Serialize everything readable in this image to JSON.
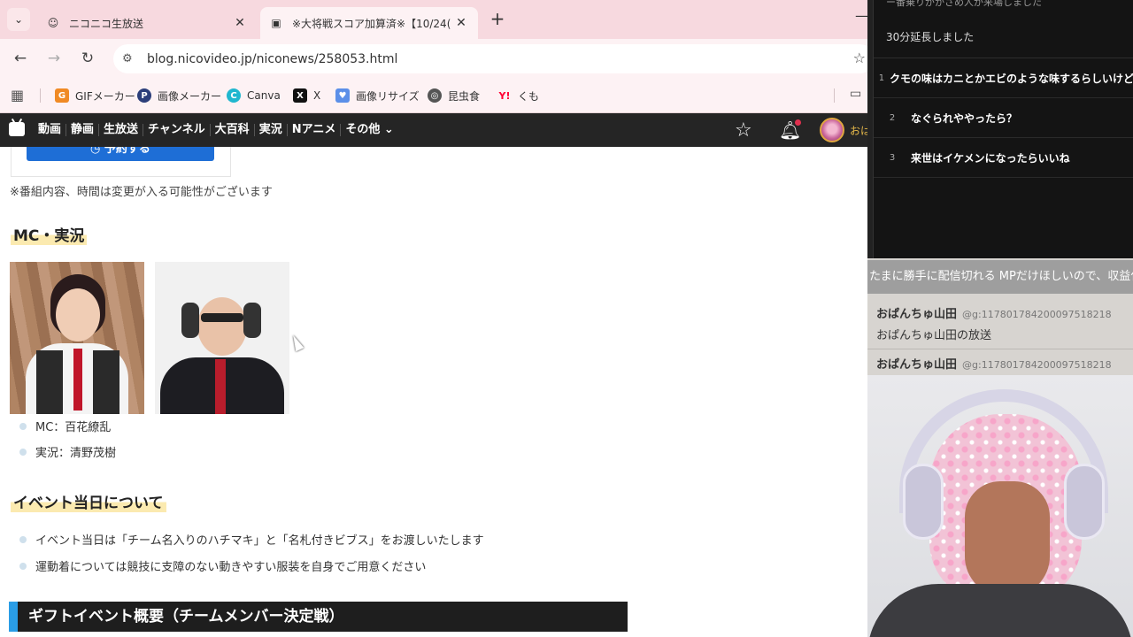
{
  "browser": {
    "tabs": [
      {
        "title": "ニコニコ生放送",
        "active": false
      },
      {
        "title": "※大将戦スコア加算済※【10/24(",
        "active": true
      }
    ],
    "url": "blog.nicovideo.jp/niconews/258053.html",
    "bookmarks": [
      {
        "label": "GIFメーカー",
        "icon": "gif-maker-icon",
        "color": "#f08a24"
      },
      {
        "label": "画像メーカー",
        "icon": "image-maker-icon",
        "color": "#2c3e7a"
      },
      {
        "label": "Canva",
        "icon": "canva-icon",
        "color": "#20b7cf"
      },
      {
        "label": "X",
        "icon": "x-icon",
        "color": "#111111"
      },
      {
        "label": "画像リサイズ",
        "icon": "resize-icon",
        "color": "#5b8fe8"
      },
      {
        "label": "昆虫食",
        "icon": "insect-food-icon",
        "color": "#555555"
      },
      {
        "label": "くも",
        "icon": "yahoo-icon",
        "color": "#ff0033"
      }
    ]
  },
  "sitenav": {
    "items": [
      "動画",
      "静画",
      "生放送",
      "チャンネル",
      "大百科",
      "実況",
      "Nアニメ",
      "その他"
    ],
    "more_suffix": "⌄",
    "user_label": "おは"
  },
  "article": {
    "reserve_label": "予約する",
    "note": "※番組内容、時間は変更が入る可能性がございます",
    "mc_heading": "MC・実況",
    "mc_items": [
      "MC：百花繚乱",
      "実況：清野茂樹"
    ],
    "event_heading": "イベント当日について",
    "event_items": [
      "イベント当日は「チーム名入りのハチマキ」と「名札付きビブス」をお渡しいたします",
      "運動着については競技に支障のない動きやすい服装を自身でご用意ください"
    ],
    "gift_heading": "ギフトイベント概要（チームメンバー決定戦）"
  },
  "stream": {
    "top_text": "ー番乗りがかさめ人が来場しました",
    "extend_text": "30分延長しました",
    "ranking": [
      {
        "rank": "1",
        "text": "クモの味はカニとかエビのような味するらしいけど"
      },
      {
        "rank": "2",
        "text": "なぐられややったら？"
      },
      {
        "rank": "3",
        "text": "来世はイケメンになったらいいね"
      }
    ]
  },
  "comments": {
    "marquee": "たまに勝手に配信切れる MPだけほしいので、収益化",
    "entries": [
      {
        "name": "おぱんちゅ山田",
        "id": "@g:117801784200097518218",
        "text": "おぱんちゅ山田の放送"
      },
      {
        "name": "おぱんちゅ山田",
        "id": "@g:117801784200097518218",
        "text": ""
      }
    ]
  },
  "colors": {
    "tabbar": "#f7d9df",
    "sitenav": "#252525",
    "reserve_button": "#1e6ed6",
    "gift_accent": "#2a9de6"
  }
}
